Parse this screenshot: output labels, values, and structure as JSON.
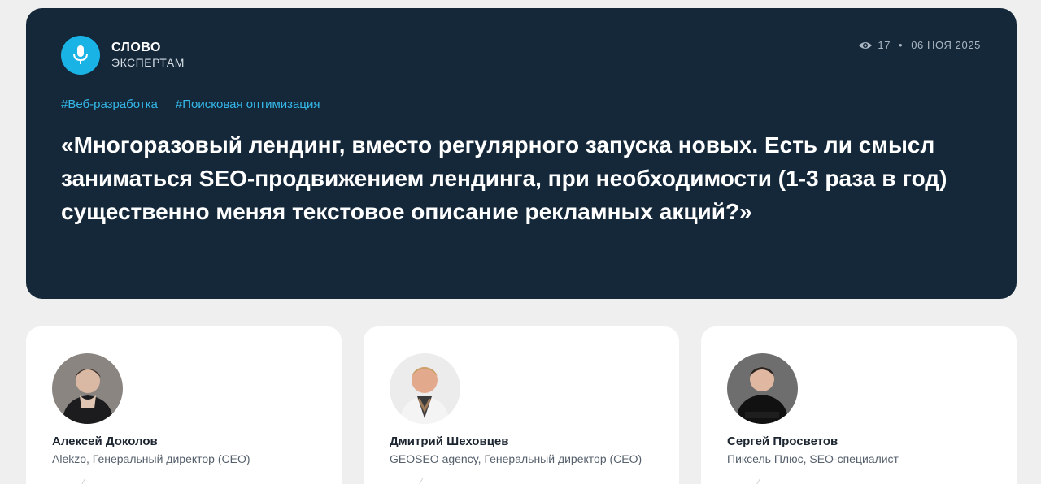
{
  "brand": {
    "title": "СЛОВО",
    "subtitle": "ЭКСПЕРТАМ",
    "icon": "microphone-icon",
    "accent": "#1ab3e6"
  },
  "meta": {
    "views": "17",
    "separator": "•",
    "date": "06 НОЯ 2025",
    "icon": "eye-icon"
  },
  "tags": [
    "#Веб-разработка",
    "#Поисковая оптимизация"
  ],
  "headline": "«Многоразовый лендинг, вместо регулярного запуска новых. Есть ли смысл заниматься SEO-продвижением лендинга, при необходимости (1-3 раза в год) существенно меняя текстовое описание рекламных акций?»",
  "experts": [
    {
      "name": "Алексей Доколов",
      "role": "Alekzo, Генеральный директор (CEO)"
    },
    {
      "name": "Дмитрий Шеховцев",
      "role": "GEOSEO agency, Генеральный директор (CEO)"
    },
    {
      "name": "Сергей Просветов",
      "role": "Пиксель Плюс, SEO-специалист"
    }
  ],
  "colors": {
    "hero_bg": "#14283a",
    "tag": "#35b7e8",
    "page_bg": "#efefef"
  }
}
